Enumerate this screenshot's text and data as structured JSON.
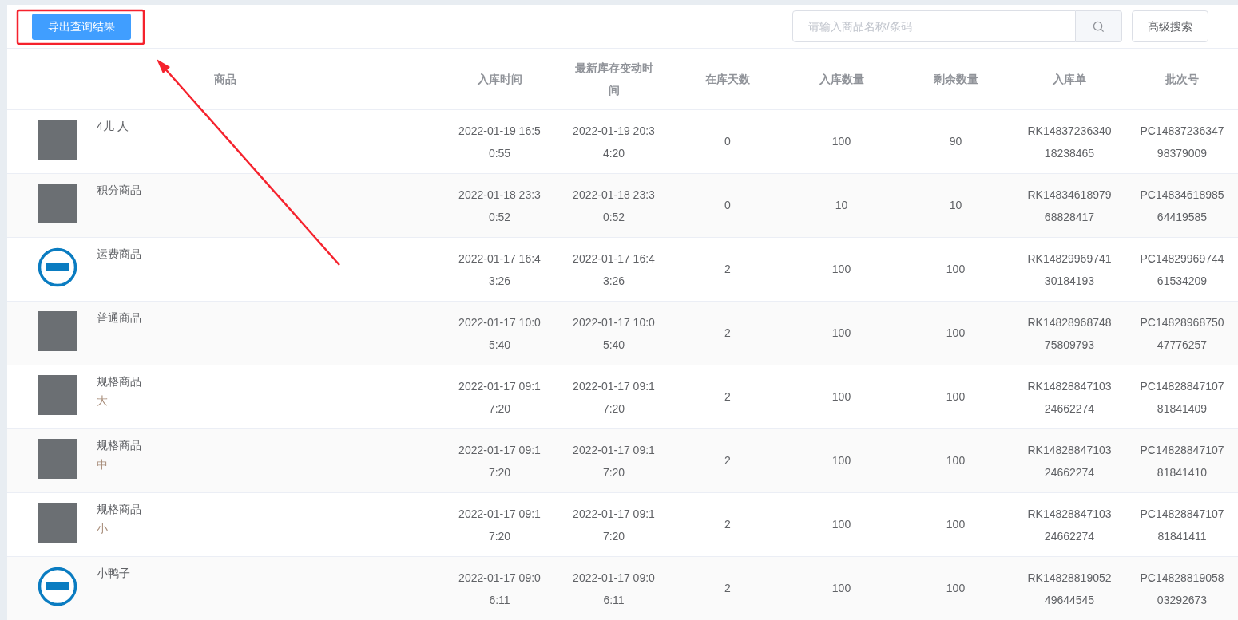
{
  "toolbar": {
    "export_button": "导出查询结果",
    "search": {
      "placeholder": "请输入商品名称/条码"
    },
    "advanced_search_button": "高级搜索"
  },
  "table": {
    "columns": [
      "商品",
      "入库时间",
      "最新库存变动时间",
      "在库天数",
      "入库数量",
      "剩余数量",
      "入库单",
      "批次号"
    ],
    "rows": [
      {
        "kind": "photo",
        "name": "4儿 人",
        "in_time": "2022-01-19 16:50:55",
        "change_time": "2022-01-19 20:34:20",
        "days": "0",
        "in_qty": "100",
        "remain": "90",
        "order": "RK1483723634018238465",
        "batch": "PC1483723634798379009"
      },
      {
        "kind": "photo",
        "name": "积分商品",
        "in_time": "2022-01-18 23:30:52",
        "change_time": "2022-01-18 23:30:52",
        "days": "0",
        "in_qty": "10",
        "remain": "10",
        "order": "RK1483461897968828417",
        "batch": "PC1483461898564419585"
      },
      {
        "kind": "logo",
        "name": "运费商品",
        "in_time": "2022-01-17 16:43:26",
        "change_time": "2022-01-17 16:43:26",
        "days": "2",
        "in_qty": "100",
        "remain": "100",
        "order": "RK1482996974130184193",
        "batch": "PC1482996974461534209"
      },
      {
        "kind": "photo",
        "name": "普通商品",
        "in_time": "2022-01-17 10:05:40",
        "change_time": "2022-01-17 10:05:40",
        "days": "2",
        "in_qty": "100",
        "remain": "100",
        "order": "RK1482896874875809793",
        "batch": "PC1482896875047776257"
      },
      {
        "kind": "photo",
        "name": "规格商品",
        "spec": "大",
        "in_time": "2022-01-17 09:17:20",
        "change_time": "2022-01-17 09:17:20",
        "days": "2",
        "in_qty": "100",
        "remain": "100",
        "order": "RK1482884710324662274",
        "batch": "PC1482884710781841409"
      },
      {
        "kind": "photo",
        "name": "规格商品",
        "spec": "中",
        "in_time": "2022-01-17 09:17:20",
        "change_time": "2022-01-17 09:17:20",
        "days": "2",
        "in_qty": "100",
        "remain": "100",
        "order": "RK1482884710324662274",
        "batch": "PC1482884710781841410"
      },
      {
        "kind": "photo",
        "name": "规格商品",
        "spec": "小",
        "in_time": "2022-01-17 09:17:20",
        "change_time": "2022-01-17 09:17:20",
        "days": "2",
        "in_qty": "100",
        "remain": "100",
        "order": "RK1482884710324662274",
        "batch": "PC1482884710781841411"
      },
      {
        "kind": "logo",
        "name": "小鸭子",
        "in_time": "2022-01-17 09:06:11",
        "change_time": "2022-01-17 09:06:11",
        "days": "2",
        "in_qty": "100",
        "remain": "100",
        "order": "RK1482881905249644545",
        "batch": "PC1482881905803292673"
      }
    ]
  }
}
